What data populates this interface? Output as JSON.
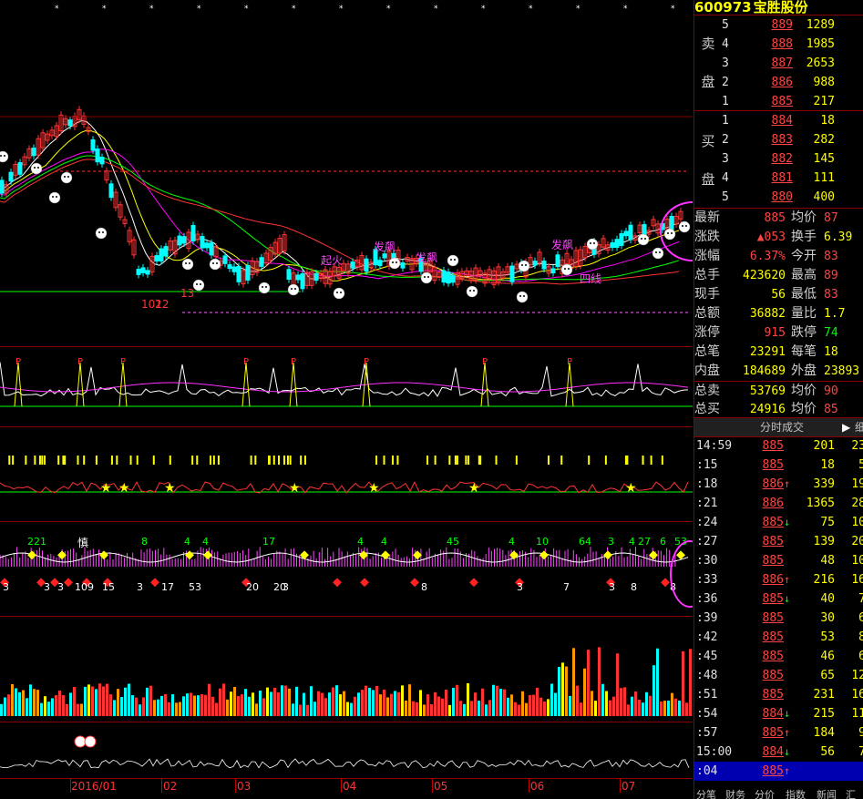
{
  "stock": {
    "code": "600973",
    "name": "宝胜股份"
  },
  "labels": {
    "sell": [
      "卖",
      "盘"
    ],
    "buy": [
      "买",
      "盘"
    ]
  },
  "sell_orders": [
    {
      "idx": "5",
      "price": "889",
      "vol": "1289"
    },
    {
      "idx": "4",
      "price": "888",
      "vol": "1985"
    },
    {
      "idx": "3",
      "price": "887",
      "vol": "2653"
    },
    {
      "idx": "2",
      "price": "886",
      "vol": "988"
    },
    {
      "idx": "1",
      "price": "885",
      "vol": "217"
    }
  ],
  "buy_orders": [
    {
      "idx": "1",
      "price": "884",
      "vol": "18"
    },
    {
      "idx": "2",
      "price": "883",
      "vol": "282"
    },
    {
      "idx": "3",
      "price": "882",
      "vol": "145"
    },
    {
      "idx": "4",
      "price": "881",
      "vol": "111"
    },
    {
      "idx": "5",
      "price": "880",
      "vol": "400"
    }
  ],
  "quote": [
    {
      "l1": "最新",
      "v1": "885",
      "l2": "均价",
      "v2": "87"
    },
    {
      "l1": "涨跌",
      "v1": "▲053",
      "l2": "换手",
      "v2": "6.39"
    },
    {
      "l1": "涨幅",
      "v1": "6.37%",
      "l2": "今开",
      "v2": "83"
    },
    {
      "l1": "总手",
      "v1": "423620",
      "l2": "最高",
      "v2": "89"
    },
    {
      "l1": "现手",
      "v1": "56",
      "l2": "最低",
      "v2": "83"
    },
    {
      "l1": "总额",
      "v1": "36882",
      "l2": "量比",
      "v2": "1.7"
    },
    {
      "l1": "涨停",
      "v1": "915",
      "l2": "跌停",
      "v2": "74"
    },
    {
      "l1": "总笔",
      "v1": "23291",
      "l2": "每笔",
      "v2": "18"
    },
    {
      "l1": "内盘",
      "v1": "184689",
      "l2": "外盘",
      "v2": "23893"
    },
    {
      "l1": "总卖",
      "v1": "53769",
      "l2": "均价",
      "v2": "90"
    },
    {
      "l1": "总买",
      "v1": "24916",
      "l2": "均价",
      "v2": "85"
    }
  ],
  "tabs": {
    "active": "分时成交",
    "next": "▶",
    "extra": "细"
  },
  "ticks": [
    {
      "time": "14:59",
      "price": "885",
      "arrow": "",
      "vol": "201",
      "cnt": "23"
    },
    {
      "time": ":15",
      "price": "885",
      "arrow": "",
      "vol": "18",
      "cnt": "5"
    },
    {
      "time": ":18",
      "price": "886",
      "arrow": "↑",
      "vol": "339",
      "cnt": "19"
    },
    {
      "time": ":21",
      "price": "886",
      "arrow": "",
      "vol": "1365",
      "cnt": "28"
    },
    {
      "time": ":24",
      "price": "885",
      "arrow": "↓",
      "vol": "75",
      "cnt": "10"
    },
    {
      "time": ":27",
      "price": "885",
      "arrow": "",
      "vol": "139",
      "cnt": "20"
    },
    {
      "time": ":30",
      "price": "885",
      "arrow": "",
      "vol": "48",
      "cnt": "10"
    },
    {
      "time": ":33",
      "price": "886",
      "arrow": "↑",
      "vol": "216",
      "cnt": "16"
    },
    {
      "time": ":36",
      "price": "885",
      "arrow": "↓",
      "vol": "40",
      "cnt": "7"
    },
    {
      "time": ":39",
      "price": "885",
      "arrow": "",
      "vol": "30",
      "cnt": "6"
    },
    {
      "time": ":42",
      "price": "885",
      "arrow": "",
      "vol": "53",
      "cnt": "8"
    },
    {
      "time": ":45",
      "price": "885",
      "arrow": "",
      "vol": "46",
      "cnt": "6"
    },
    {
      "time": ":48",
      "price": "885",
      "arrow": "",
      "vol": "65",
      "cnt": "12"
    },
    {
      "time": ":51",
      "price": "885",
      "arrow": "",
      "vol": "231",
      "cnt": "16"
    },
    {
      "time": ":54",
      "price": "884",
      "arrow": "↓",
      "vol": "215",
      "cnt": "11"
    },
    {
      "time": ":57",
      "price": "885",
      "arrow": "↑",
      "vol": "184",
      "cnt": "9"
    },
    {
      "time": "15:00",
      "price": "884",
      "arrow": "↓",
      "vol": "56",
      "cnt": "7"
    },
    {
      "time": ":04",
      "price": "885",
      "arrow": "↑",
      "vol": "",
      "cnt": ""
    }
  ],
  "bottom_tabs": [
    "分笔",
    "财务",
    "分价",
    "指数",
    "新闻",
    "汇"
  ],
  "months": [
    "2016/01",
    "02",
    "03",
    "04",
    "05",
    "06",
    "07"
  ],
  "chart_annotations": {
    "texts": [
      "发飙",
      "发飙",
      "发飙",
      "起火",
      "慎",
      "四线",
      "2",
      "1012",
      "13",
      "16"
    ],
    "bottom_numbers": [
      "3",
      "3",
      "3",
      "109",
      "15",
      "3",
      "17",
      "53",
      "20",
      "20",
      "3",
      "8",
      "3",
      "7",
      "3",
      "8",
      "8"
    ],
    "top_numbers": [
      "221",
      "8",
      "4",
      "4",
      "17",
      "4",
      "4",
      "45",
      "4",
      "10",
      "64",
      "3",
      "4",
      "27",
      "6",
      "53"
    ]
  },
  "colors": {
    "up": "#ff3333",
    "down": "#00ffff",
    "bg": "#000000",
    "grid": "#8a0000",
    "highlight": "#ff33ff"
  }
}
